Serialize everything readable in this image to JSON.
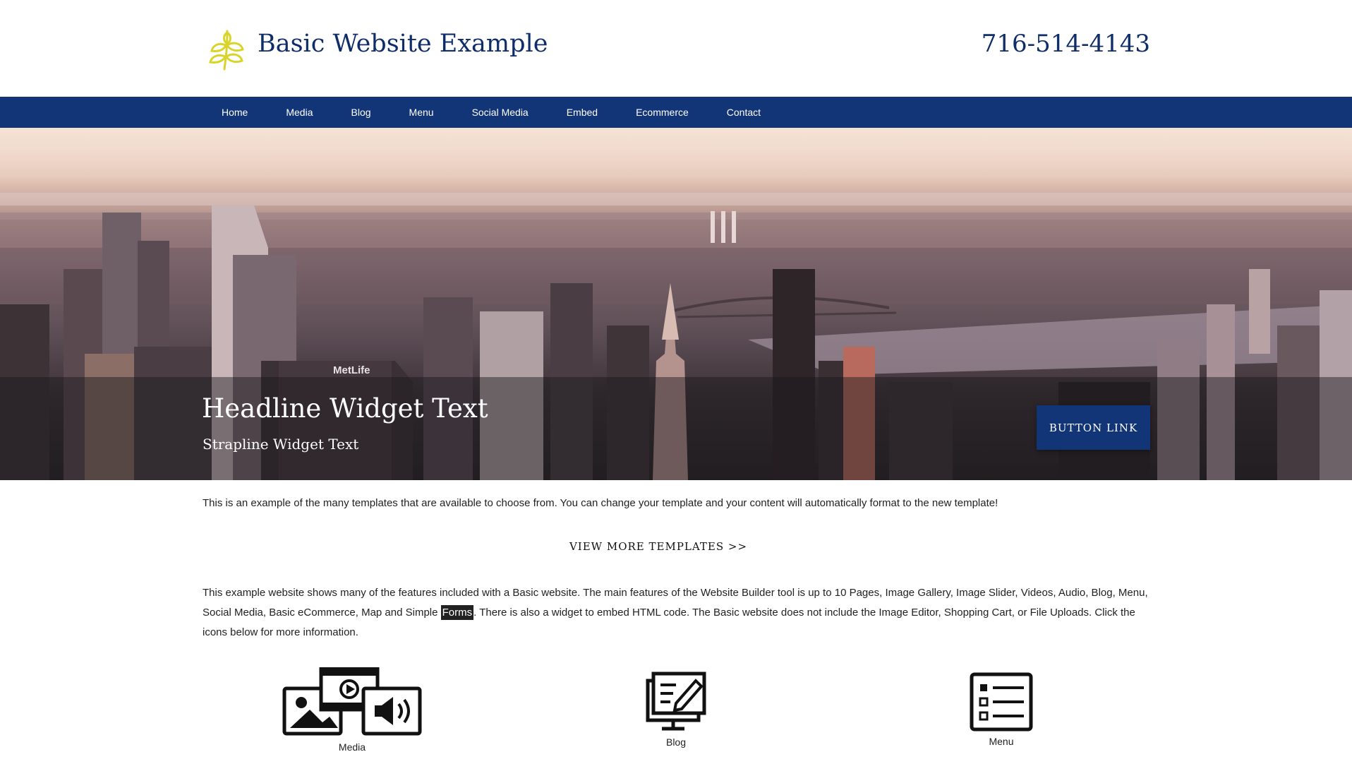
{
  "header": {
    "site_title": "Basic Website Example",
    "phone": "716-514-4143",
    "logo_icon": "leaf-sprig-icon",
    "logo_color": "#d8d42a",
    "title_color": "#0f2d69"
  },
  "nav": {
    "background": "#123577",
    "items": [
      {
        "label": "Home"
      },
      {
        "label": "Media"
      },
      {
        "label": "Blog"
      },
      {
        "label": "Menu"
      },
      {
        "label": "Social Media"
      },
      {
        "label": "Embed"
      },
      {
        "label": "Ecommerce"
      },
      {
        "label": "Contact"
      }
    ]
  },
  "hero": {
    "image": "city-skyline-photo",
    "headline": "Headline Widget Text",
    "strapline": "Strapline Widget Text",
    "button_label": "BUTTON LINK",
    "building_sign": "MetLife"
  },
  "content": {
    "intro": "This is an example of the many templates that are available to choose from. You can change your template and your content will automatically format to the new template!",
    "view_more": "VIEW MORE TEMPLATES >>",
    "body_before": "This example website shows many of the features included with a Basic website. The main features of the Website Builder tool is up to 10 Pages, Image Gallery, Image Slider, Videos, Audio, Blog, Menu, Social Media, Basic eCommerce, Map and Simple ",
    "body_highlight": "Forms",
    "body_after": ". There is also a widget to embed HTML code. The Basic website does not include the Image Editor, Shopping Cart, or File Uploads. Click the icons below for more information."
  },
  "features": [
    {
      "label": "Media",
      "icon": "media-icon"
    },
    {
      "label": "Blog",
      "icon": "blog-icon"
    },
    {
      "label": "Menu",
      "icon": "menu-list-icon"
    }
  ]
}
